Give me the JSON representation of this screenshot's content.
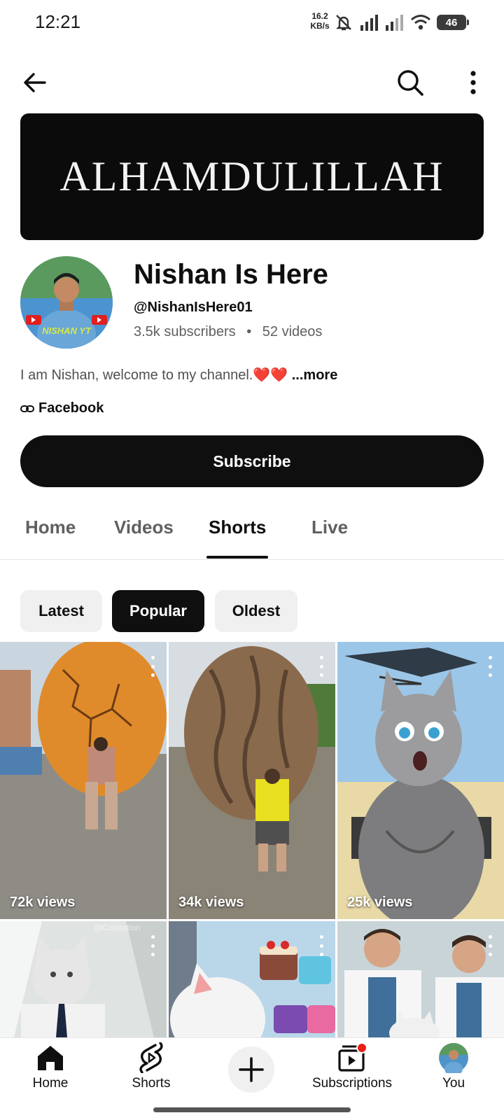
{
  "status_bar": {
    "time": "12:21",
    "net_speed": "16.2",
    "net_unit": "KB/s",
    "battery": "46"
  },
  "banner": {
    "text": "ALHAMDULILLAH"
  },
  "channel": {
    "name": "Nishan Is Here",
    "handle": "@NishanIsHere01",
    "subscribers": "3.5k subscribers",
    "separator": "•",
    "videos": "52 videos",
    "description": "I am Nishan, welcome to my channel.❤️❤️",
    "more_label": "...more",
    "link_label": "Facebook",
    "avatar_text": "NISHAN YT"
  },
  "subscribe_label": "Subscribe",
  "tabs": [
    {
      "label": "Home"
    },
    {
      "label": "Videos"
    },
    {
      "label": "Shorts"
    },
    {
      "label": "Live"
    }
  ],
  "active_tab": "Shorts",
  "chips": [
    {
      "label": "Latest"
    },
    {
      "label": "Popular"
    },
    {
      "label": "Oldest"
    }
  ],
  "selected_chip": "Popular",
  "shorts": [
    {
      "views": "72k views",
      "thumbnail": "giant-egg-thumbnail"
    },
    {
      "views": "34k views",
      "thumbnail": "giant-walnut-thumbnail"
    },
    {
      "views": "25k views",
      "thumbnail": "cat-helicopter-thumbnail"
    },
    {
      "views": "",
      "thumbnail": "cat-office-thumbnail",
      "watermark": "@Catmation"
    },
    {
      "views": "",
      "thumbnail": "cat-cakes-thumbnail"
    },
    {
      "views": "",
      "thumbnail": "doctors-cat-thumbnail"
    }
  ],
  "bottom_nav": [
    {
      "label": "Home",
      "icon": "home-icon"
    },
    {
      "label": "Shorts",
      "icon": "shorts-icon"
    },
    {
      "label": "",
      "icon": "create-icon"
    },
    {
      "label": "Subscriptions",
      "icon": "subscriptions-icon"
    },
    {
      "label": "You",
      "icon": "avatar-icon"
    }
  ],
  "colors": {
    "primary_text": "#0f0f0f",
    "secondary_text": "#606060",
    "notification_dot": "#e62117"
  }
}
